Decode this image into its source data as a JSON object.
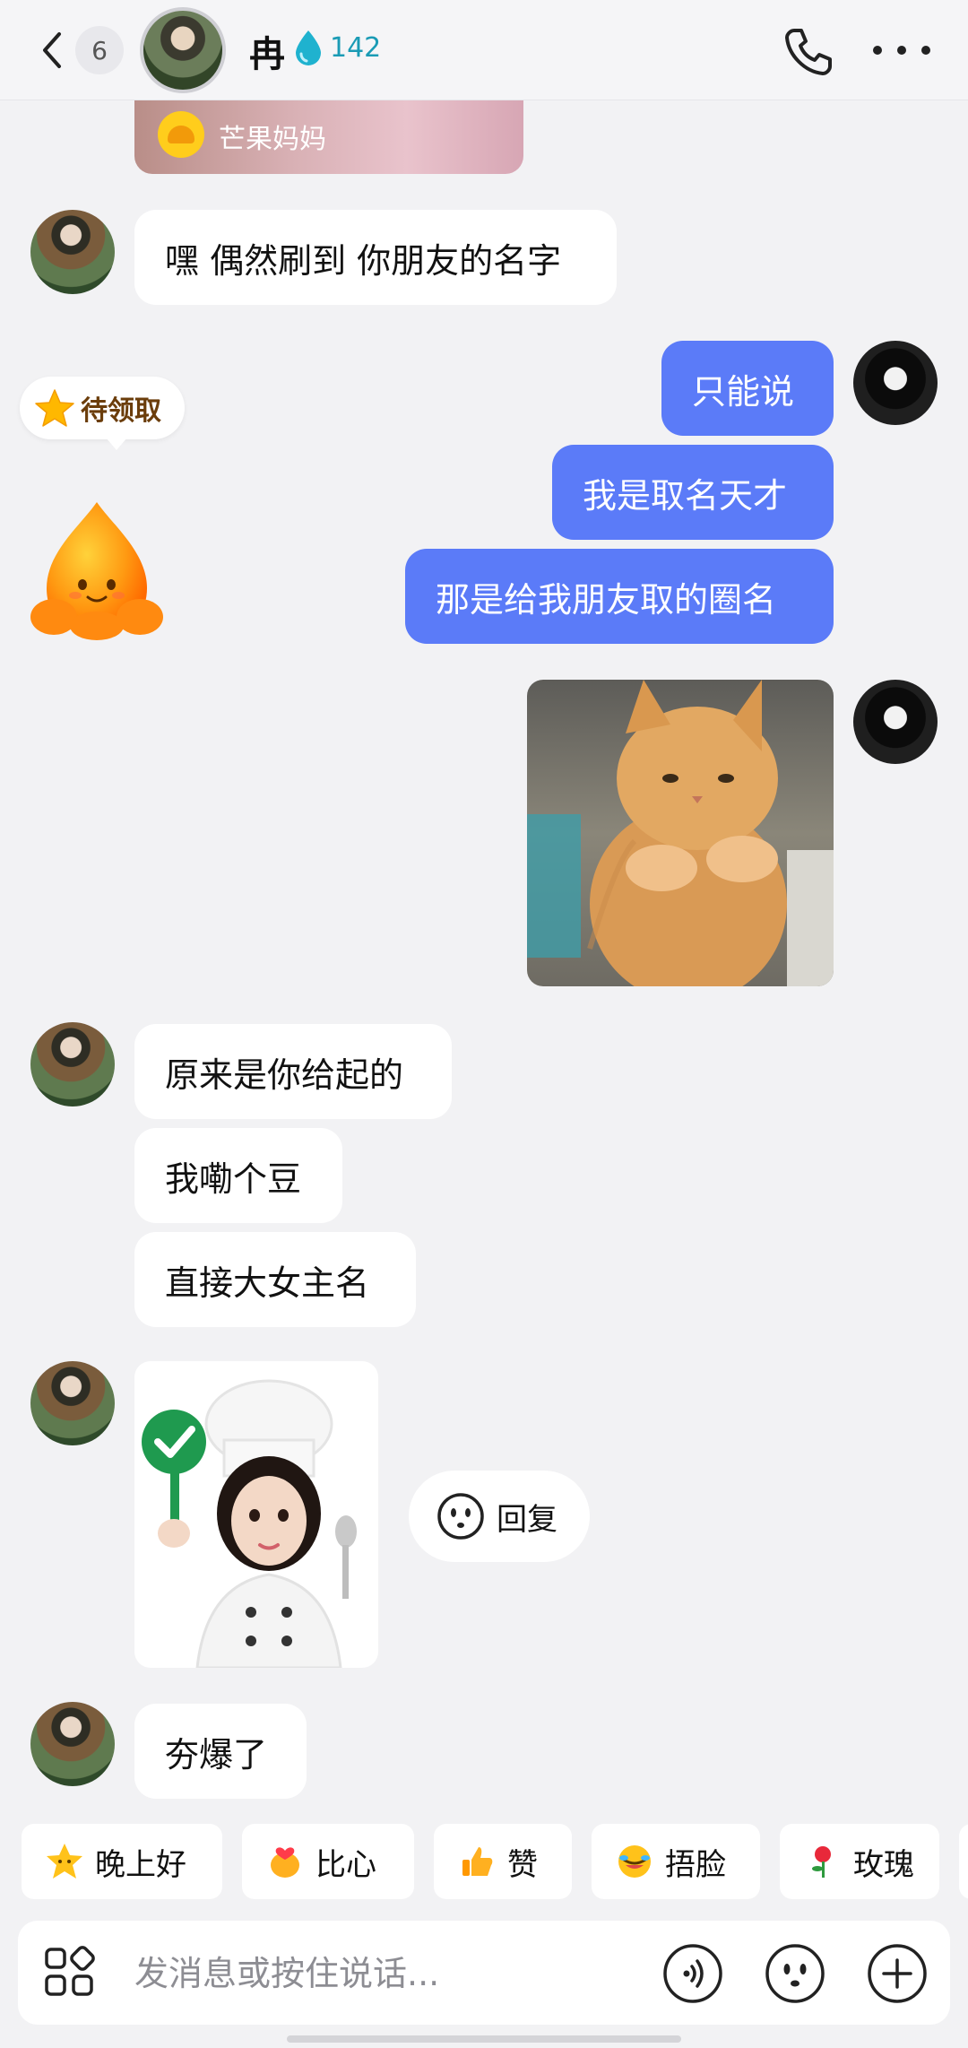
{
  "header": {
    "unread_count": "6",
    "contact_name": "冉",
    "streak_count": "142"
  },
  "top_card": {
    "brand_name": "芒果妈妈"
  },
  "reward": {
    "label": "待领取"
  },
  "messages": [
    {
      "side": "in",
      "text": "嘿 偶然刷到 你朋友的名字"
    },
    {
      "side": "out",
      "text": "只能说"
    },
    {
      "side": "out",
      "text": "我是取名天才"
    },
    {
      "side": "out",
      "text": "那是给我朋友取的圈名"
    },
    {
      "side": "in",
      "text": "原来是你给起的"
    },
    {
      "side": "in",
      "text": "我嘞个豆"
    },
    {
      "side": "in",
      "text": "直接大女主名"
    },
    {
      "side": "in",
      "text": "夯爆了"
    }
  ],
  "reply_chip": {
    "label": "回复"
  },
  "quick_replies": [
    {
      "icon": "star-face-icon",
      "label": "晚上好"
    },
    {
      "icon": "heart-hands-icon",
      "label": "比心"
    },
    {
      "icon": "thumbs-up-icon",
      "label": "赞"
    },
    {
      "icon": "facepalm-icon",
      "label": "捂脸"
    },
    {
      "icon": "rose-icon",
      "label": "玫瑰"
    }
  ],
  "input_bar": {
    "placeholder": "发消息或按住说话..."
  },
  "colors": {
    "outgoing_bubble": "#5b7bf8",
    "incoming_bubble": "#ffffff",
    "background": "#f2f2f4",
    "streak": "#1a9bb5"
  }
}
